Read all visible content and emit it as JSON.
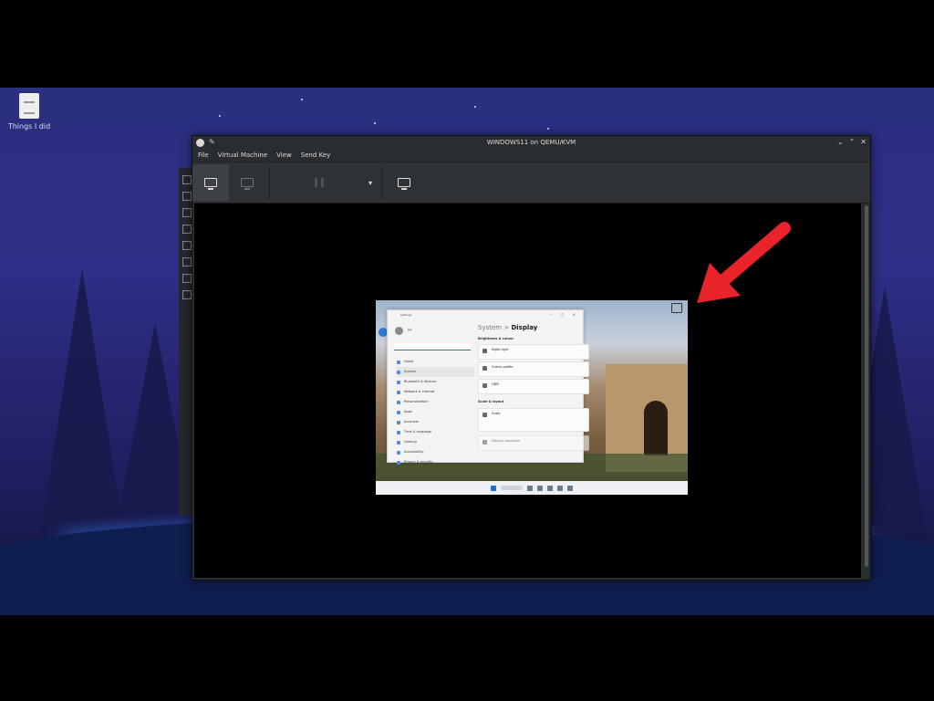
{
  "desktop": {
    "icon_label": "Things I did"
  },
  "window": {
    "title": "WINDOWS11 on QEMU/KVM",
    "controls": [
      "⌄",
      "⌃",
      "✕"
    ]
  },
  "menu": {
    "items": [
      "File",
      "Virtual Machine",
      "View",
      "Send Key"
    ]
  },
  "toolbar": {
    "dropdown_glyph": "▾"
  },
  "guest": {
    "settings": {
      "window_title": "Settings",
      "user_name": "Jay",
      "breadcrumb_parent": "System",
      "breadcrumb_separator": ">",
      "breadcrumb_current": "Display",
      "nav_items": [
        "Home",
        "System",
        "Bluetooth & devices",
        "Network & internet",
        "Personalization",
        "Apps",
        "Accounts",
        "Time & language",
        "Gaming",
        "Accessibility",
        "Privacy & security"
      ],
      "section_brightness": "Brightness & colour",
      "section_scale": "Scale & layout",
      "cards": [
        {
          "title": "Night light"
        },
        {
          "title": "Colour profile"
        },
        {
          "title": "HDR"
        },
        {
          "title": "Scale"
        },
        {
          "title": "Display resolution"
        }
      ]
    }
  }
}
